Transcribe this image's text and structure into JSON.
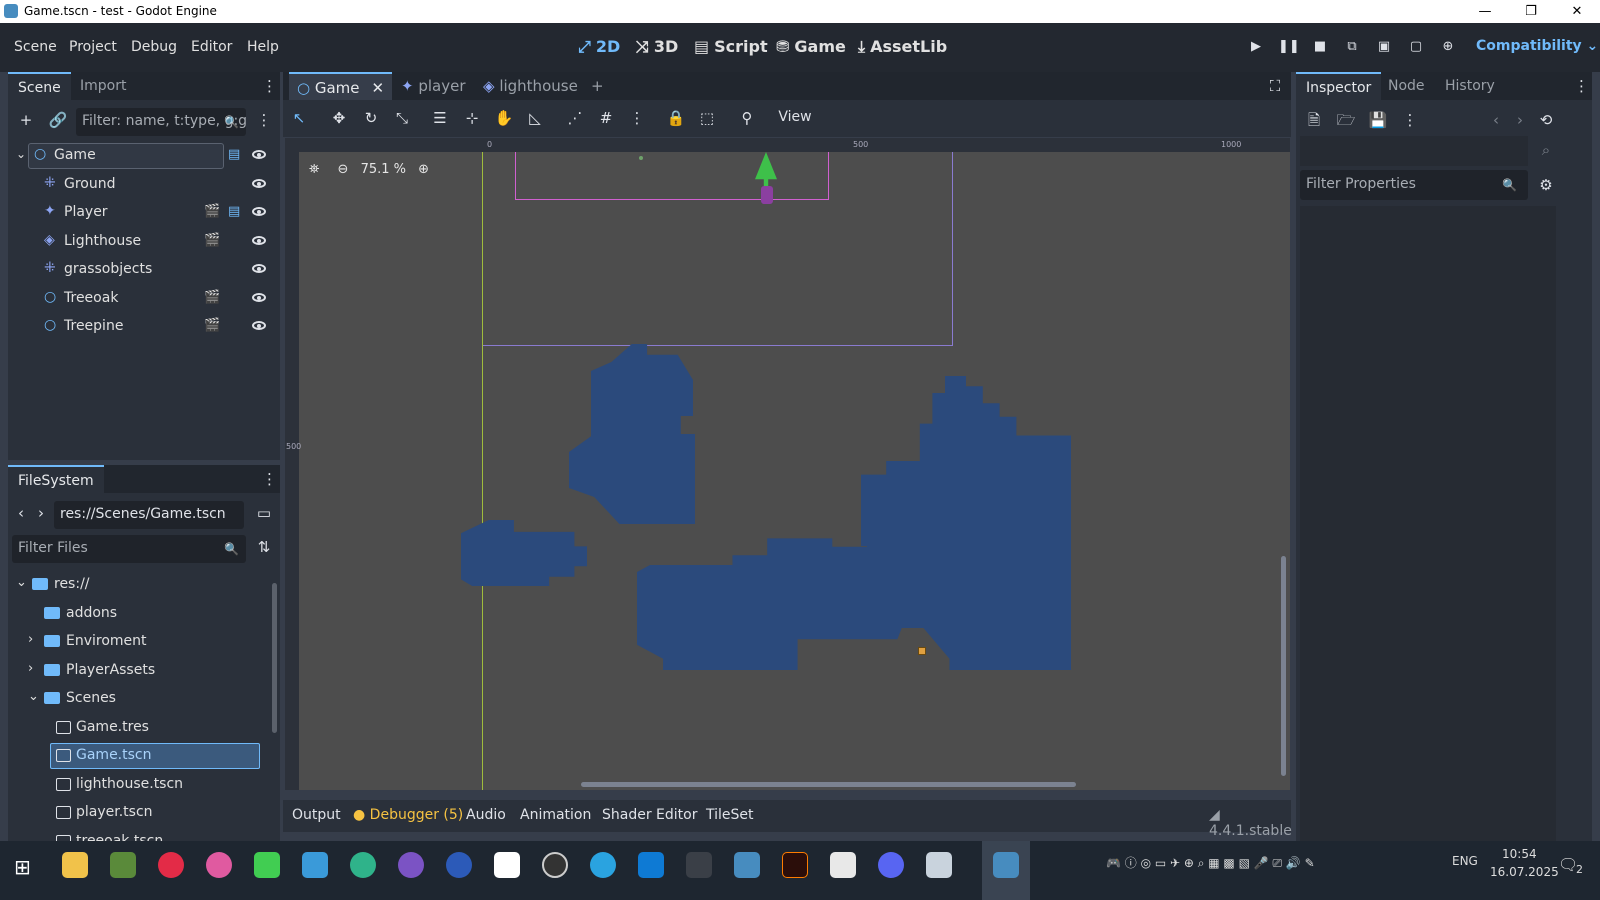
{
  "window": {
    "title": "Game.tscn - test - Godot Engine",
    "controls": [
      "—",
      "❐",
      "✕"
    ]
  },
  "menu": [
    "Scene",
    "Project",
    "Debug",
    "Editor",
    "Help"
  ],
  "workspaces": [
    {
      "label": "2D",
      "icon": "⤢"
    },
    {
      "label": "3D",
      "icon": "⤨"
    },
    {
      "label": "Script",
      "icon": "▤"
    },
    {
      "label": "Game",
      "icon": "⛃"
    },
    {
      "label": "AssetLib",
      "icon": "⤓"
    }
  ],
  "renderer": "Compatibility",
  "scene_dock": {
    "tabs": [
      "Scene",
      "Import"
    ],
    "filter_placeholder": "Filter: name, t:type, g:group",
    "nodes": [
      {
        "name": "Game",
        "icon": "circle-node-icon",
        "script": true,
        "instance": false
      },
      {
        "name": "Ground",
        "icon": "tilemap-icon",
        "script": false,
        "instance": false
      },
      {
        "name": "Player",
        "icon": "character-icon",
        "script": true,
        "instance": true
      },
      {
        "name": "Lighthouse",
        "icon": "static-body-icon",
        "script": false,
        "instance": true
      },
      {
        "name": "grassobjects",
        "icon": "tilemap-icon",
        "script": false,
        "instance": false
      },
      {
        "name": "Treeoak",
        "icon": "circle-node-icon",
        "script": false,
        "instance": true
      },
      {
        "name": "Treepine",
        "icon": "circle-node-icon",
        "script": false,
        "instance": true
      }
    ]
  },
  "filesystem": {
    "tab": "FileSystem",
    "path": "res://Scenes/Game.tscn",
    "filter_placeholder": "Filter Files",
    "items": [
      {
        "label": "res://",
        "type": "folder",
        "indent": 0,
        "arrow": "⌄"
      },
      {
        "label": "addons",
        "type": "folder",
        "indent": 1,
        "arrow": ""
      },
      {
        "label": "Enviroment",
        "type": "folder",
        "indent": 1,
        "arrow": "›"
      },
      {
        "label": "PlayerAssets",
        "type": "folder",
        "indent": 1,
        "arrow": "›"
      },
      {
        "label": "Scenes",
        "type": "folder",
        "indent": 1,
        "arrow": "⌄"
      },
      {
        "label": "Game.tres",
        "type": "file",
        "indent": 2,
        "arrow": ""
      },
      {
        "label": "Game.tscn",
        "type": "file",
        "indent": 2,
        "arrow": "",
        "selected": true
      },
      {
        "label": "lighthouse.tscn",
        "type": "file",
        "indent": 2,
        "arrow": ""
      },
      {
        "label": "player.tscn",
        "type": "file",
        "indent": 2,
        "arrow": ""
      },
      {
        "label": "treeoak.tscn",
        "type": "file",
        "indent": 2,
        "arrow": ""
      }
    ]
  },
  "editor_tabs": [
    {
      "label": "Game",
      "active": true
    },
    {
      "label": "player",
      "active": false
    },
    {
      "label": "lighthouse",
      "active": false
    }
  ],
  "toolbar": {
    "view_label": "View"
  },
  "viewport": {
    "zoom": "75.1 %",
    "ruler_top": [
      "0",
      "500",
      "1000"
    ],
    "ruler_left": [
      "500"
    ]
  },
  "inspector": {
    "tabs": [
      "Inspector",
      "Node",
      "History"
    ],
    "filter_placeholder": "Filter Properties"
  },
  "bottom_tabs": [
    "Output",
    "Debugger (5)",
    "Audio",
    "Animation",
    "Shader Editor",
    "TileSet"
  ],
  "version": "4.4.1.stable",
  "taskbar": {
    "lang": "ENG",
    "time": "10:54",
    "date": "16.07.2025",
    "notifications": "2"
  },
  "colors": {
    "accent": "#70bafa",
    "water": "#2b4a7c",
    "viewport_bg": "#4d4d4d",
    "panel": "#2a303a"
  }
}
